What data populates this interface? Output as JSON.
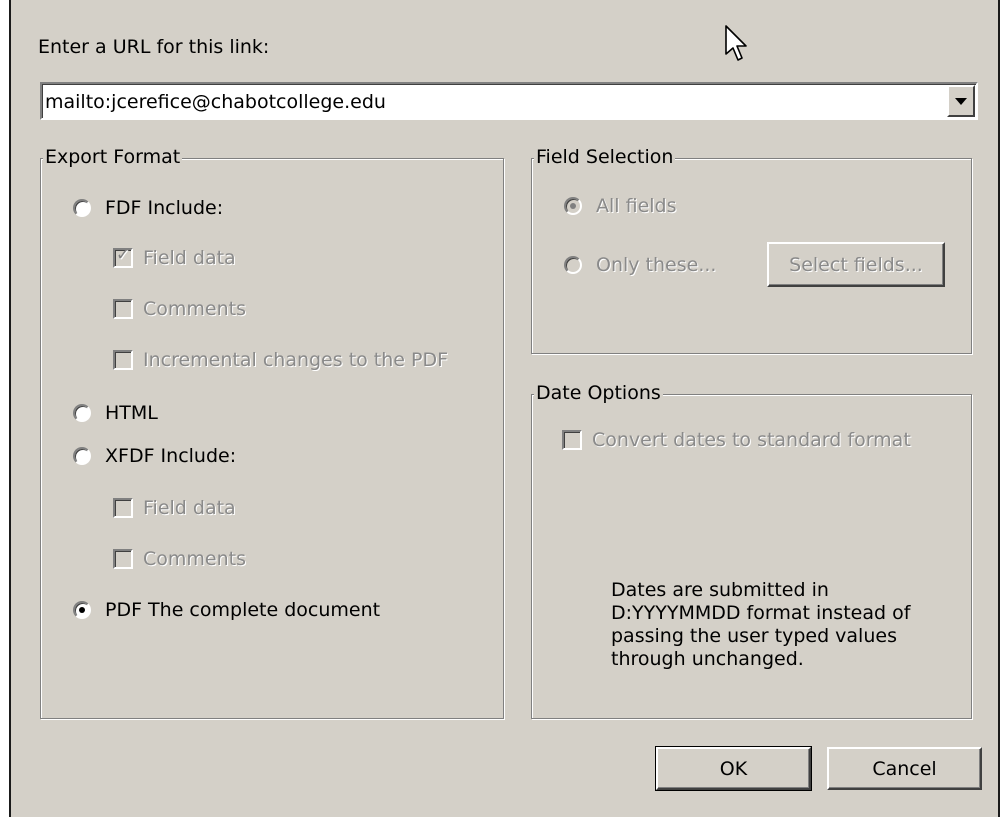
{
  "url": {
    "label": "Enter a URL for this link:",
    "value": "mailto:jcerefice@chabotcollege.edu"
  },
  "export_format": {
    "title": "Export Format",
    "fdf_label": "FDF  Include:",
    "fdf_options": [
      "Field data",
      "Comments",
      "Incremental changes to the PDF"
    ],
    "html_label": "HTML",
    "xfdf_label": "XFDF  Include:",
    "xfdf_options": [
      "Field data",
      "Comments"
    ],
    "pdf_label": "PDF  The complete document",
    "selected": "PDF",
    "fdf_field_data_checked": true
  },
  "field_selection": {
    "title": "Field Selection",
    "all_fields": "All fields",
    "only_these": "Only these...",
    "select_fields_button": "Select fields...",
    "selected": "All fields"
  },
  "date_options": {
    "title": "Date Options",
    "convert_label": "Convert dates to standard format",
    "note_lines": [
      "Dates are submitted in",
      "D:YYYYMMDD format instead of",
      "passing the user typed values",
      "through unchanged."
    ]
  },
  "buttons": {
    "ok": "OK",
    "cancel": "Cancel"
  },
  "icons": {
    "dropdown": "chevron-down-icon",
    "cursor": "mouse-pointer-icon"
  }
}
